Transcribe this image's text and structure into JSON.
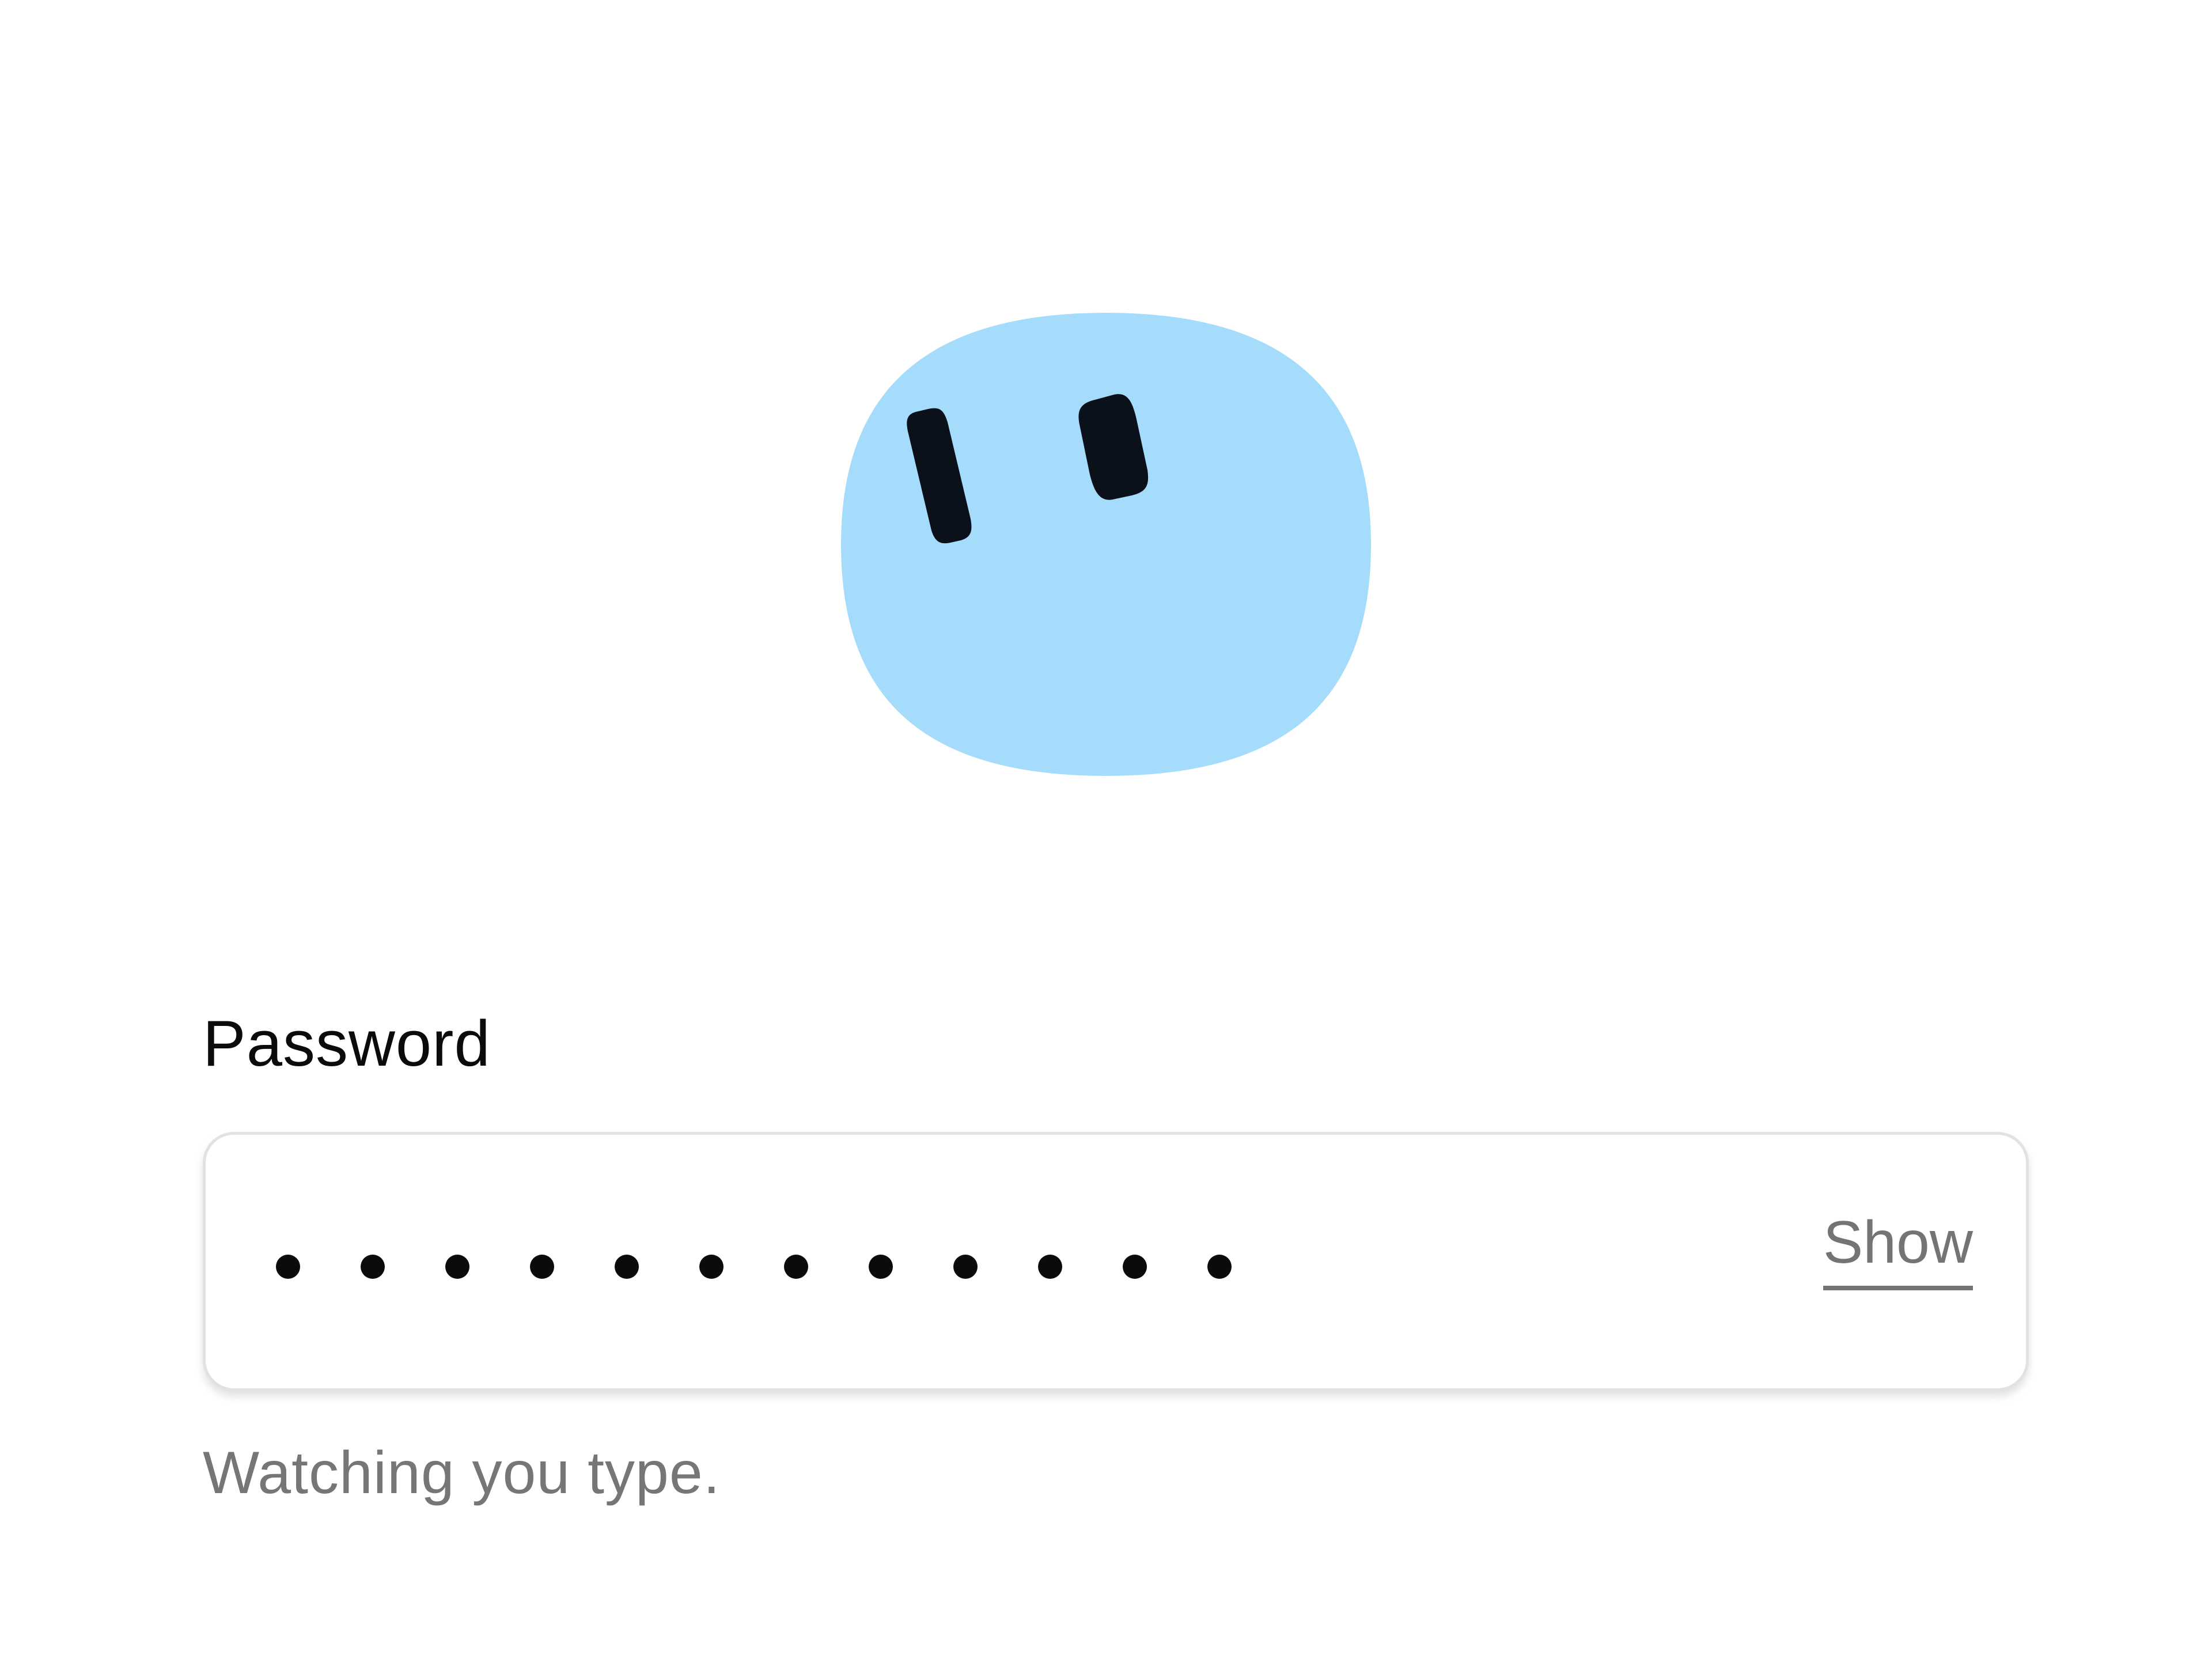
{
  "colors": {
    "mascot_body": "#a6dcfb",
    "mascot_eyes": "#0a111b",
    "label_text": "#0b0b0b",
    "muted_text": "#747474",
    "field_border": "#e2e2e2"
  },
  "mascot": {
    "icon": "blob-face-icon",
    "eyes": "eye-icon"
  },
  "password": {
    "label": "Password",
    "masked_character_count": 12,
    "show_label": "Show",
    "helper_text": "Watching you type."
  }
}
